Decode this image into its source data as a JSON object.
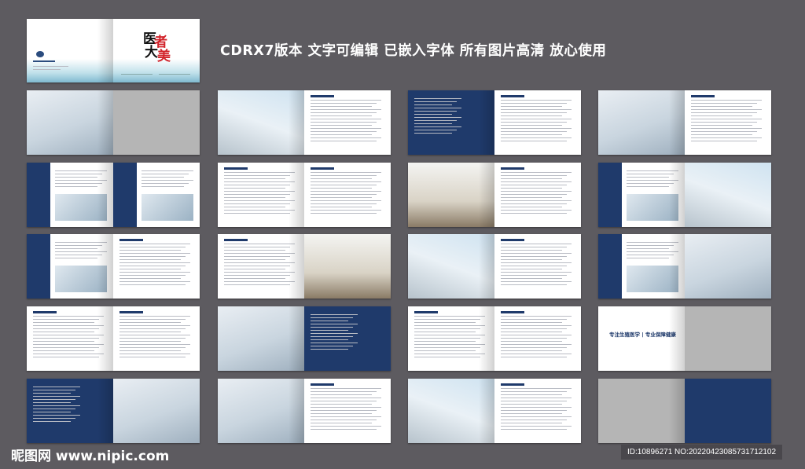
{
  "headline": "CDRX7版本   文字可编辑   已嵌入字体   所有图片高清  放心使用",
  "cover": {
    "calligraphy": "医者大美"
  },
  "closing_spread": {
    "slogan": "专注生殖医学 | 专业保障健康"
  },
  "watermark": "昵图网 www.nipic.com",
  "image_id": "ID:10896271 NO:20220423085731712102",
  "colors": {
    "accent": "#1f3a6b",
    "background": "#5d5b60"
  }
}
